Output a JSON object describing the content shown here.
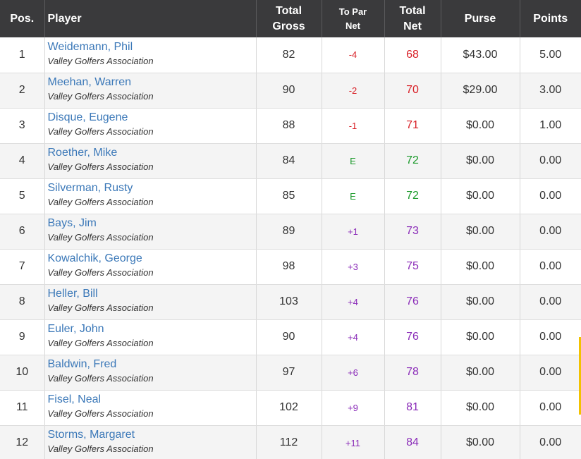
{
  "headers": {
    "pos": "Pos.",
    "player": "Player",
    "gross_l1": "Total",
    "gross_l2": "Gross",
    "topar_l1": "To Par",
    "topar_l2": "Net",
    "net_l1": "Total",
    "net_l2": "Net",
    "purse": "Purse",
    "points": "Points"
  },
  "colors": {
    "header_bg": "#3a3a3c",
    "player_link": "#3b78b8",
    "under_par": "#d81f26",
    "even_par": "#1b9a2b",
    "over_par": "#8a2bb8"
  },
  "rows": [
    {
      "pos": "1",
      "name": "Weidemann, Phil",
      "club": "Valley Golfers Association",
      "gross": "82",
      "topar": "-4",
      "net": "68",
      "purse": "$43.00",
      "points": "5.00",
      "status": "neg"
    },
    {
      "pos": "2",
      "name": "Meehan, Warren",
      "club": "Valley Golfers Association",
      "gross": "90",
      "topar": "-2",
      "net": "70",
      "purse": "$29.00",
      "points": "3.00",
      "status": "neg"
    },
    {
      "pos": "3",
      "name": "Disque, Eugene",
      "club": "Valley Golfers Association",
      "gross": "88",
      "topar": "-1",
      "net": "71",
      "purse": "$0.00",
      "points": "1.00",
      "status": "neg"
    },
    {
      "pos": "4",
      "name": "Roether, Mike",
      "club": "Valley Golfers Association",
      "gross": "84",
      "topar": "E",
      "net": "72",
      "purse": "$0.00",
      "points": "0.00",
      "status": "even"
    },
    {
      "pos": "5",
      "name": "Silverman, Rusty",
      "club": "Valley Golfers Association",
      "gross": "85",
      "topar": "E",
      "net": "72",
      "purse": "$0.00",
      "points": "0.00",
      "status": "even"
    },
    {
      "pos": "6",
      "name": "Bays, Jim",
      "club": "Valley Golfers Association",
      "gross": "89",
      "topar": "+1",
      "net": "73",
      "purse": "$0.00",
      "points": "0.00",
      "status": "over"
    },
    {
      "pos": "7",
      "name": "Kowalchik, George",
      "club": "Valley Golfers Association",
      "gross": "98",
      "topar": "+3",
      "net": "75",
      "purse": "$0.00",
      "points": "0.00",
      "status": "over"
    },
    {
      "pos": "8",
      "name": "Heller, Bill",
      "club": "Valley Golfers Association",
      "gross": "103",
      "topar": "+4",
      "net": "76",
      "purse": "$0.00",
      "points": "0.00",
      "status": "over"
    },
    {
      "pos": "9",
      "name": "Euler, John",
      "club": "Valley Golfers Association",
      "gross": "90",
      "topar": "+4",
      "net": "76",
      "purse": "$0.00",
      "points": "0.00",
      "status": "over"
    },
    {
      "pos": "10",
      "name": "Baldwin, Fred",
      "club": "Valley Golfers Association",
      "gross": "97",
      "topar": "+6",
      "net": "78",
      "purse": "$0.00",
      "points": "0.00",
      "status": "over"
    },
    {
      "pos": "11",
      "name": "Fisel, Neal",
      "club": "Valley Golfers Association",
      "gross": "102",
      "topar": "+9",
      "net": "81",
      "purse": "$0.00",
      "points": "0.00",
      "status": "over"
    },
    {
      "pos": "12",
      "name": "Storms, Margaret",
      "club": "Valley Golfers Association",
      "gross": "112",
      "topar": "+11",
      "net": "84",
      "purse": "$0.00",
      "points": "0.00",
      "status": "over"
    }
  ]
}
